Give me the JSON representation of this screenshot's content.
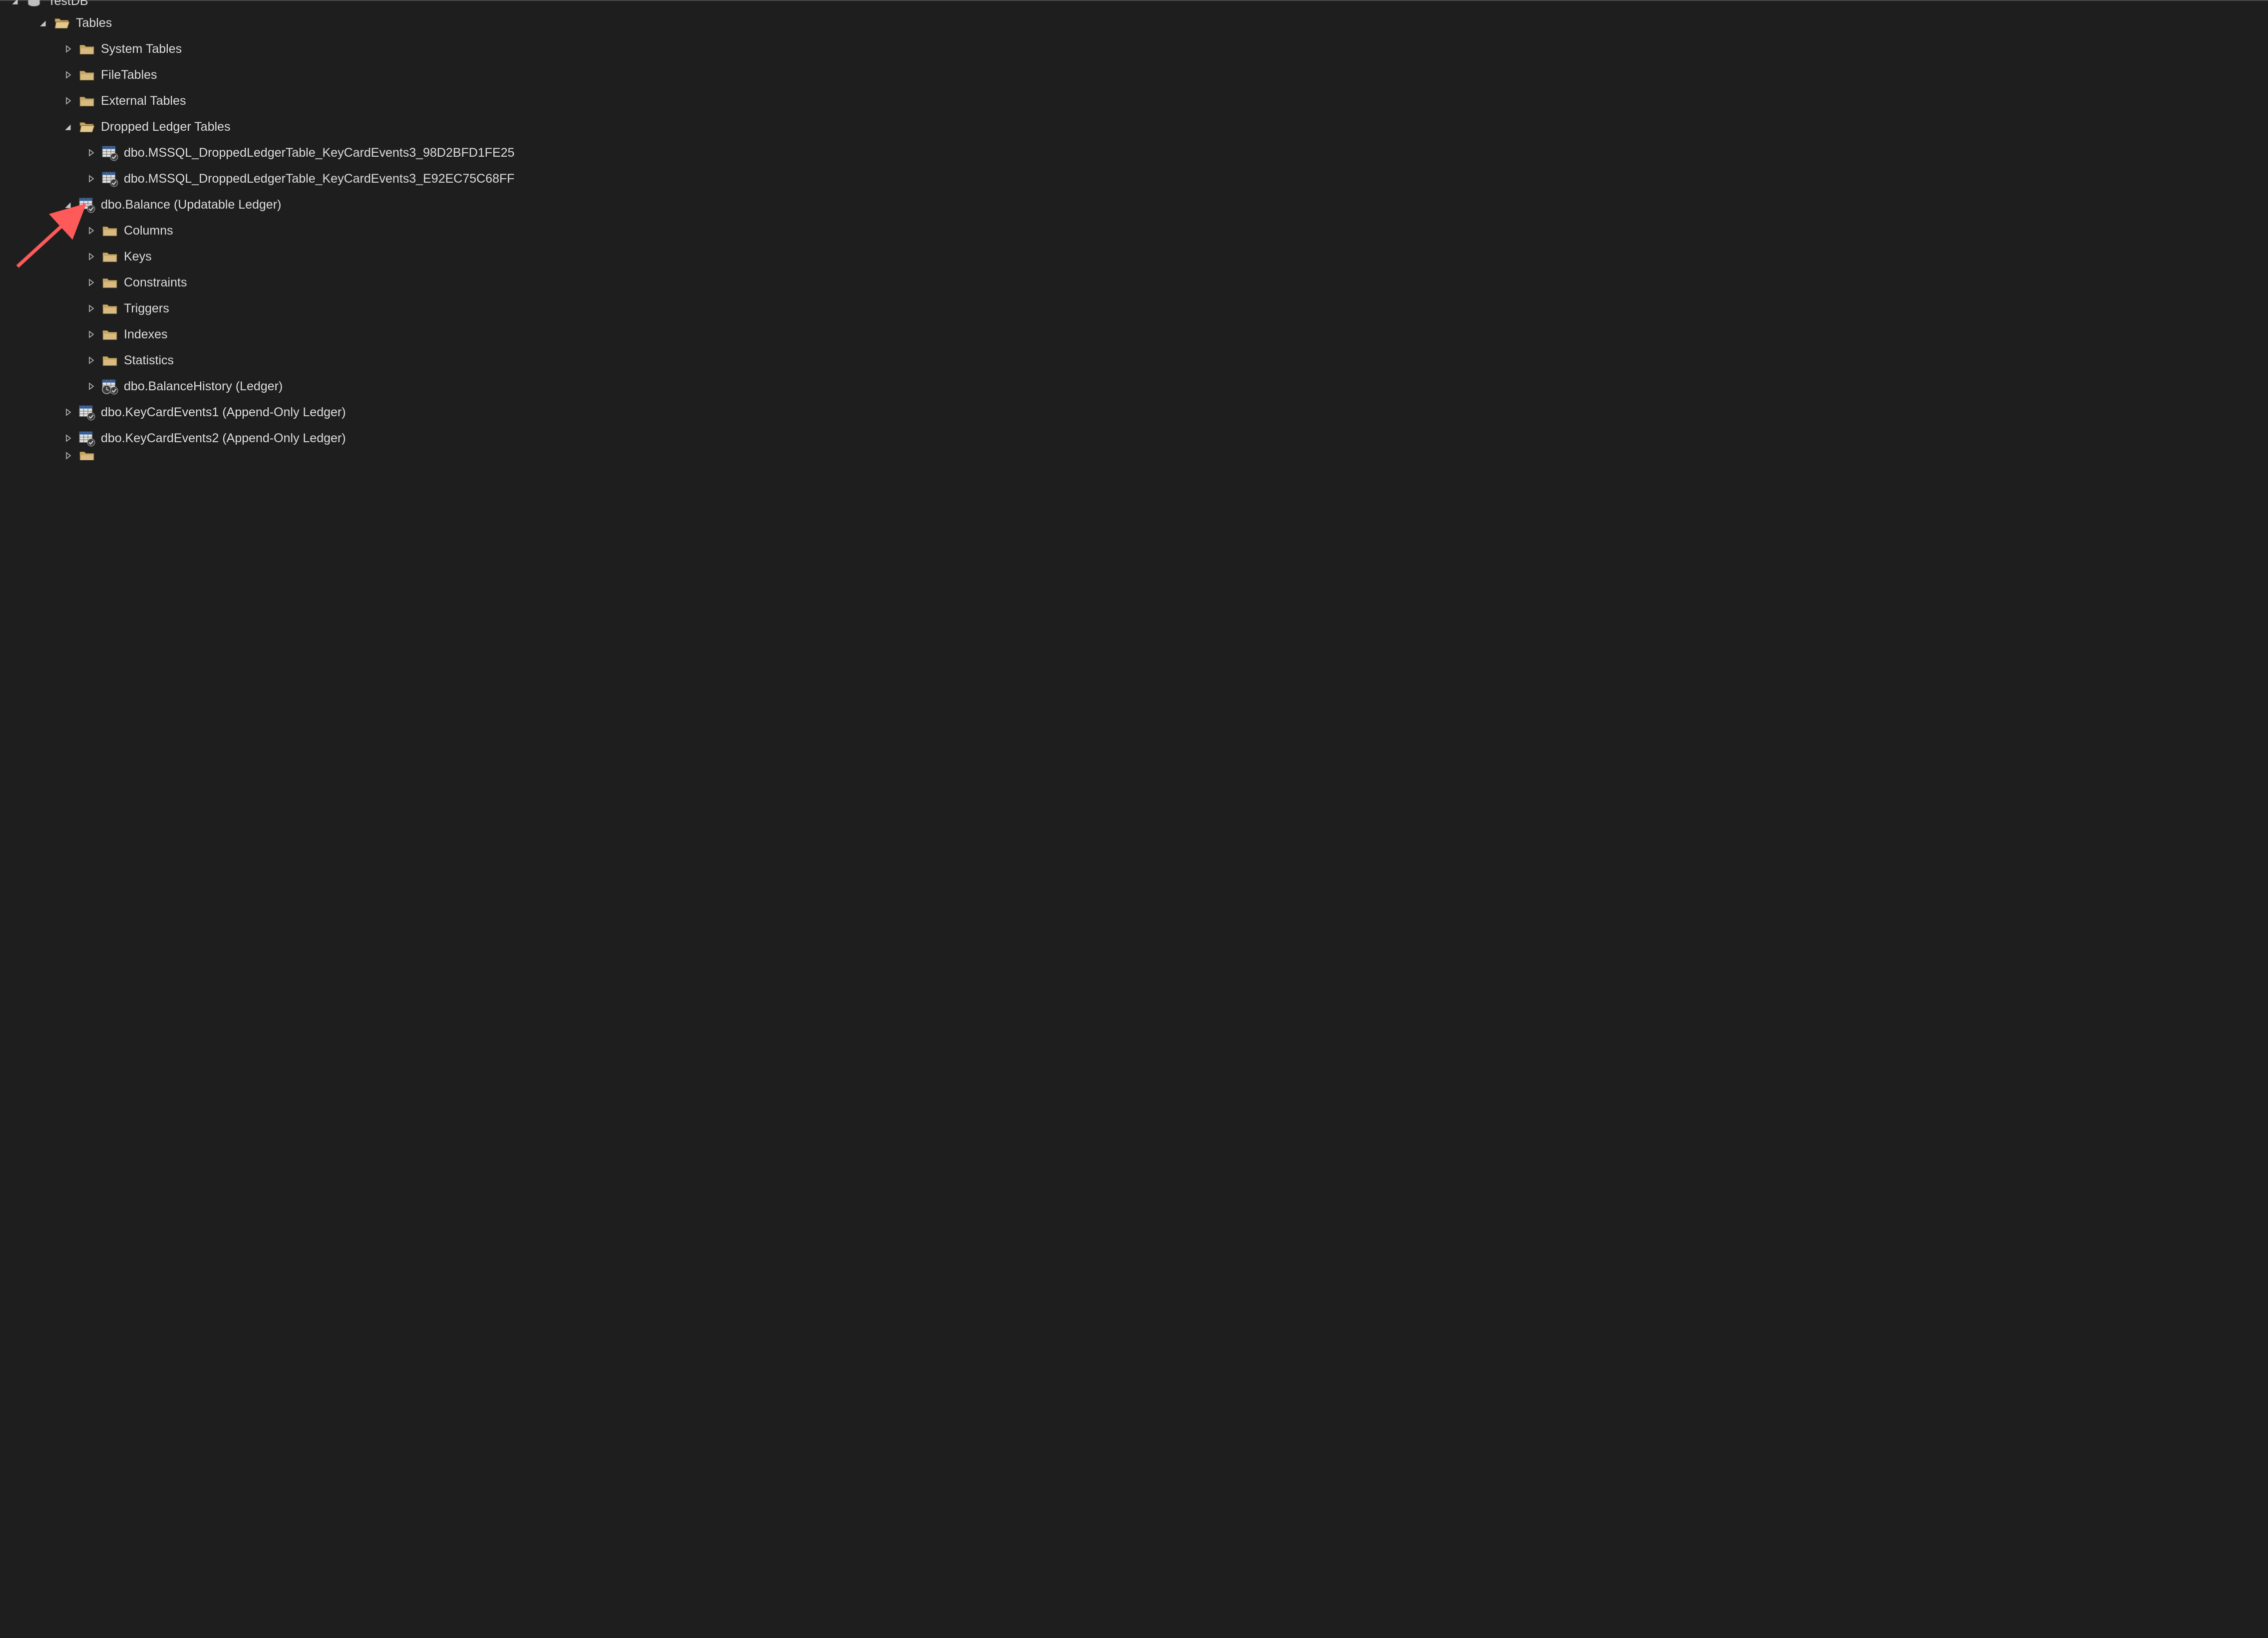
{
  "tree": {
    "database": "TestDB",
    "tables_label": "Tables",
    "system_tables": "System Tables",
    "file_tables": "FileTables",
    "external_tables": "External Tables",
    "dropped_ledger_tables": "Dropped Ledger Tables",
    "dropped1": "dbo.MSSQL_DroppedLedgerTable_KeyCardEvents3_98D2BFD1FE25",
    "dropped2": "dbo.MSSQL_DroppedLedgerTable_KeyCardEvents3_E92EC75C68FF",
    "balance": "dbo.Balance (Updatable Ledger)",
    "columns": "Columns",
    "keys": "Keys",
    "constraints": "Constraints",
    "triggers": "Triggers",
    "indexes": "Indexes",
    "statistics": "Statistics",
    "balance_history": "dbo.BalanceHistory (Ledger)",
    "keycard1": "dbo.KeyCardEvents1 (Append-Only Ledger)",
    "keycard2": "dbo.KeyCardEvents2 (Append-Only Ledger)"
  },
  "colors": {
    "bg": "#1e1e1e",
    "text": "#dcdcdc",
    "folder": "#d6b87c",
    "folder_dark": "#8a6f3f",
    "arrow_annotation": "#ff5a5a",
    "expander_open": "#b0b0b0",
    "expander_closed": "#b0b0b0",
    "table_icon": "#bfbfbf"
  }
}
